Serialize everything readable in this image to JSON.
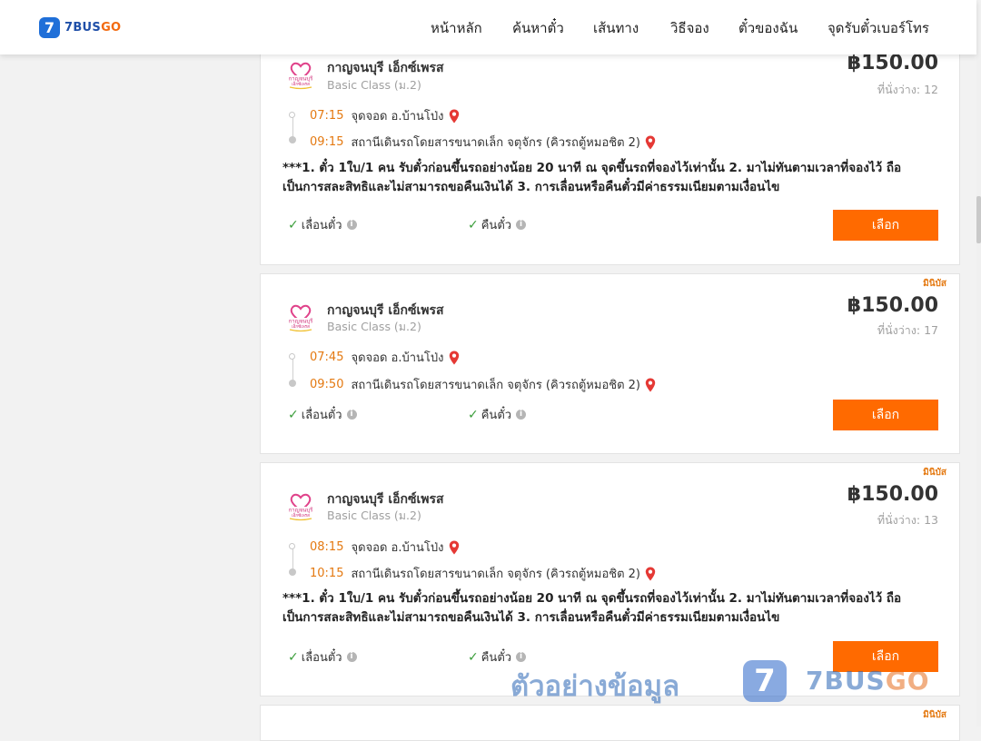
{
  "brand": {
    "badge": "7",
    "name_part1": "7BUS",
    "name_part2": "GO"
  },
  "nav": [
    {
      "label": "หน้าหลัก"
    },
    {
      "label": "ค้นหาตั๋ว"
    },
    {
      "label": "เส้นทาง"
    },
    {
      "label": "วิธีจอง"
    },
    {
      "label": "ตั๋วของฉัน"
    },
    {
      "label": "จุดรับตั๋วเบอร์โทร"
    }
  ],
  "results": [
    {
      "tag": "",
      "operator": "กาญจนบุรี เอ็กซ์เพรส",
      "class": "Basic Class (ม.2)",
      "price": "฿150.00",
      "seats": "ที่นั่งว่าง: 12",
      "depart_time": "07:15",
      "depart_place": "จุดจอด อ.บ้านโป่ง",
      "arrive_time": "09:15",
      "arrive_place": "สถานีเดินรถโดยสารขนาดเล็ก จตุจักร (คิวรถตู้หมอชิต 2)",
      "note_line1": "***1. ตั๋ว 1ใบ/1 คน รับตั๋วก่อนขึ้นรถอย่างน้อย 20 นาที ณ จุดขึ้นรถที่จองไว้เท่านั้น 2. มาไม่ทันตามเวลาที่จองไว้ ถือ",
      "note_line2": "เป็นการสละสิทธิและไม่สามารถขอคืนเงินได้ 3. การเลื่อนหรือคืนตั๋วมีค่าธรรมเนียมตามเงื่อนไข",
      "change_label": "เลื่อนตั๋ว",
      "refund_label": "คืนตั๋ว",
      "button": "เลือก"
    },
    {
      "tag": "มินิบัส",
      "operator": "กาญจนบุรี เอ็กซ์เพรส",
      "class": "Basic Class (ม.2)",
      "price": "฿150.00",
      "seats": "ที่นั่งว่าง: 17",
      "depart_time": "07:45",
      "depart_place": "จุดจอด อ.บ้านโป่ง",
      "arrive_time": "09:50",
      "arrive_place": "สถานีเดินรถโดยสารขนาดเล็ก จตุจักร (คิวรถตู้หมอชิต 2)",
      "change_label": "เลื่อนตั๋ว",
      "refund_label": "คืนตั๋ว",
      "button": "เลือก"
    },
    {
      "tag": "มินิบัส",
      "operator": "กาญจนบุรี เอ็กซ์เพรส",
      "class": "Basic Class (ม.2)",
      "price": "฿150.00",
      "seats": "ที่นั่งว่าง: 13",
      "depart_time": "08:15",
      "depart_place": "จุดจอด อ.บ้านโป่ง",
      "arrive_time": "10:15",
      "arrive_place": "สถานีเดินรถโดยสารขนาดเล็ก จตุจักร (คิวรถตู้หมอชิต 2)",
      "note_line1": "***1. ตั๋ว 1ใบ/1 คน รับตั๋วก่อนขึ้นรถอย่างน้อย 20 นาที ณ จุดขึ้นรถที่จองไว้เท่านั้น 2. มาไม่ทันตามเวลาที่จองไว้ ถือ",
      "note_line2": "เป็นการสละสิทธิและไม่สามารถขอคืนเงินได้ 3. การเลื่อนหรือคืนตั๋วมีค่าธรรมเนียมตามเงื่อนไข",
      "change_label": "เลื่อนตั๋ว",
      "refund_label": "คืนตั๋ว",
      "button": "เลือก"
    },
    {
      "tag": "มินิบัส"
    }
  ],
  "watermark": {
    "text": "ตัวอย่างข้อมูล",
    "badge": "7",
    "logo_part1": "7BUS",
    "logo_part2": "GO"
  },
  "colors": {
    "accent": "#ff6a00",
    "time": "#e47911",
    "brand_blue": "#1f6fd8",
    "check": "#3a9d3a"
  }
}
